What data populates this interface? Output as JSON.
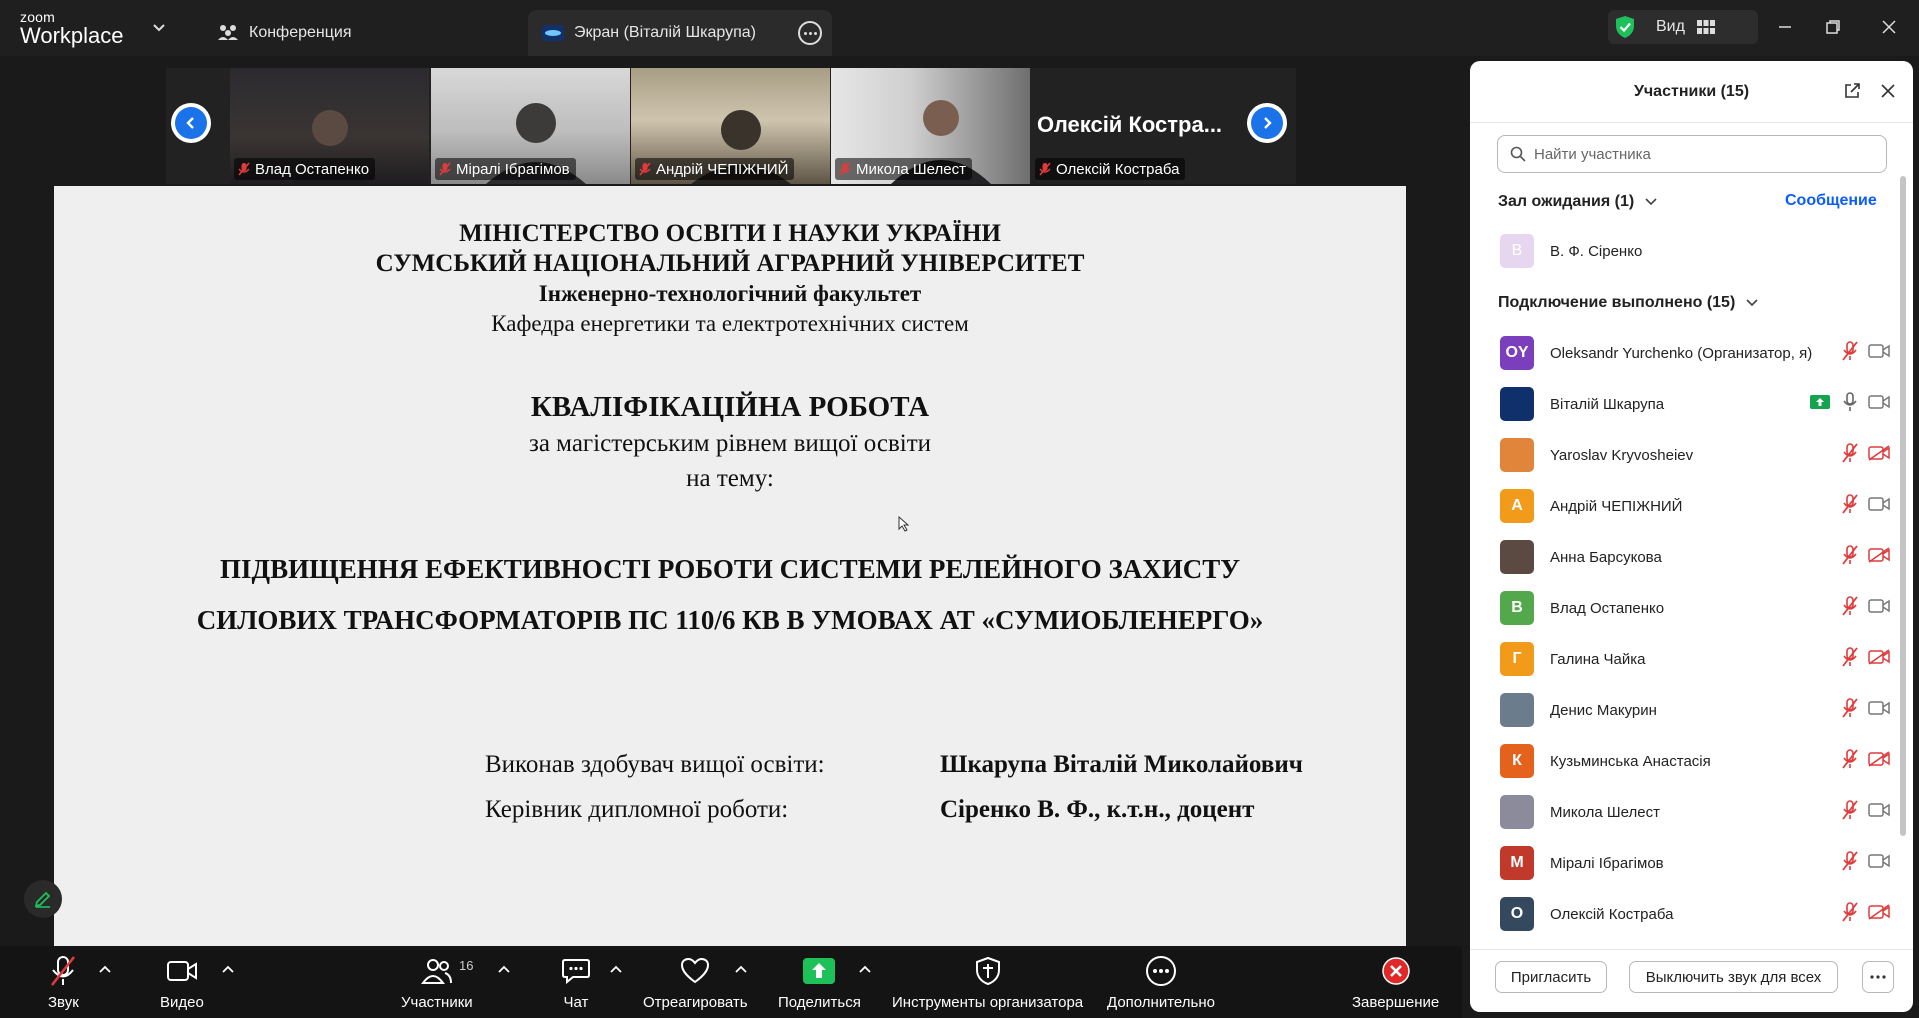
{
  "titlebar": {
    "logo_line1": "zoom",
    "logo_line2": "Workplace",
    "tab_conference": "Конференция",
    "tab_screen": "Экран (Віталій Шкарупа)",
    "view_label": "Вид"
  },
  "thumbnails": [
    {
      "name": "Влад Остапенко"
    },
    {
      "name": "Міралі Ібрагімов"
    },
    {
      "name": "Андрій ЧЕПІЖНИЙ"
    },
    {
      "name": "Микола Шелест"
    },
    {
      "name": "Олексій Костраба",
      "big_name": "Олексій Костра..."
    }
  ],
  "slide": {
    "line1": "МІНІСТЕРСТВО ОСВІТИ І НАУКИ УКРАЇНИ",
    "line2": "СУМСЬКИЙ НАЦІОНАЛЬНИЙ АГРАРНИЙ УНІВЕРСИТЕТ",
    "line3": "Інженерно-технологічний факультет",
    "line4": "Кафедра енергетики та електротехнічних систем",
    "work_title": "КВАЛІФІКАЦІЙНА РОБОТА",
    "level": "за магістерським рівнем вищої освіти",
    "topic_intro": "на тему:",
    "topic_line1": "ПІДВИЩЕННЯ ЕФЕКТИВНОСТІ РОБОТИ СИСТЕМИ РЕЛЕЙНОГО ЗАХИСТУ",
    "topic_line2": "СИЛОВИХ ТРАНСФОРМАТОРІВ ПС 110/6 КВ В УМОВАХ АТ «СУМИОБЛЕНЕРГО»",
    "author_label": "Виконав здобувач вищої освіти:",
    "author_value": "Шкарупа Віталій Миколайович",
    "supervisor_label": "Керівник дипломної роботи:",
    "supervisor_value": "Сіренко В. Ф., к.т.н., доцент"
  },
  "toolbar": {
    "audio": "Звук",
    "video": "Видео",
    "participants": "Участники",
    "participants_count": "16",
    "chat": "Чат",
    "react": "Отреагировать",
    "share": "Поделиться",
    "host_tools": "Инструменты организатора",
    "more": "Дополнительно",
    "end": "Завершение"
  },
  "panel": {
    "title": "Участники (15)",
    "search_placeholder": "Найти участника",
    "waiting_room": "Зал ожидания (1)",
    "message_link": "Сообщение",
    "waiting": [
      {
        "initial": "В",
        "name": "В. Ф. Сіренко"
      }
    ],
    "connected_title": "Подключение выполнено (15)",
    "participants": [
      {
        "initial": "OY",
        "name": "Oleksandr Yurchenko (Организатор, я)",
        "color": "#7b3fbe",
        "mic": "muted",
        "cam": "on"
      },
      {
        "initial": "",
        "name": "Віталій Шкарупа",
        "color": "#10306b",
        "mic": "on",
        "cam": "on",
        "sharing": true
      },
      {
        "initial": "",
        "name": "Yaroslav Kryvosheiev",
        "color": "#e0853a",
        "mic": "muted",
        "cam": "off"
      },
      {
        "initial": "А",
        "name": "Андрій ЧЕПІЖНИЙ",
        "color": "#f29a1a",
        "mic": "muted",
        "cam": "on"
      },
      {
        "initial": "",
        "name": "Анна Барсукова",
        "color": "#5a4a42",
        "mic": "muted",
        "cam": "off"
      },
      {
        "initial": "В",
        "name": "Влад Остапенко",
        "color": "#52a84a",
        "mic": "muted",
        "cam": "on"
      },
      {
        "initial": "Г",
        "name": "Галина Чайка",
        "color": "#f29a1a",
        "mic": "muted",
        "cam": "off"
      },
      {
        "initial": "",
        "name": "Денис Макурин",
        "color": "#6b7d8c",
        "mic": "muted",
        "cam": "on"
      },
      {
        "initial": "К",
        "name": "Кузьминська Анастасія",
        "color": "#e4621b",
        "mic": "muted",
        "cam": "off"
      },
      {
        "initial": "",
        "name": "Микола Шелест",
        "color": "#8b8b9b",
        "mic": "muted",
        "cam": "on"
      },
      {
        "initial": "М",
        "name": "Міралі Ібрагімов",
        "color": "#c0392b",
        "mic": "muted",
        "cam": "on"
      },
      {
        "initial": "О",
        "name": "Олексій Костраба",
        "color": "#34495e",
        "mic": "muted",
        "cam": "off"
      }
    ],
    "invite": "Пригласить",
    "mute_all": "Выключить звук для всех"
  }
}
